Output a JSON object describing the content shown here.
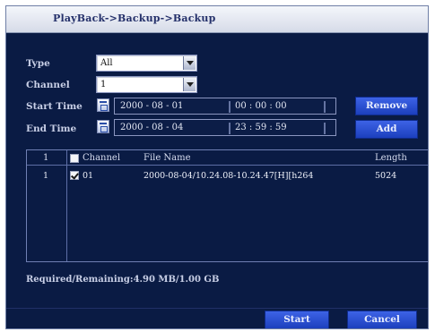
{
  "window": {
    "title": "PlayBack->Backup->Backup"
  },
  "form": {
    "type_label": "Type",
    "type_value": "All",
    "channel_label": "Channel",
    "channel_value": "1",
    "start_label": "Start Time",
    "end_label": "End Time",
    "start": {
      "date": "2000  - 08 - 01",
      "time": "00 : 00 : 00"
    },
    "end": {
      "date": "2000  - 08 - 04",
      "time": "23 : 59 : 59"
    }
  },
  "buttons": {
    "remove": "Remove",
    "add": "Add",
    "start": "Start",
    "cancel": "Cancel"
  },
  "table": {
    "header_index": "1",
    "columns": [
      "Channel",
      "File Name",
      "Length"
    ],
    "rows": [
      {
        "index": "1",
        "checked": true,
        "channel": "01",
        "file": "2000-08-04/10.24.08-10.24.47[H][h264",
        "length": "5024"
      }
    ]
  },
  "status": {
    "text": "Required/Remaining:4.90 MB/1.00 GB"
  }
}
